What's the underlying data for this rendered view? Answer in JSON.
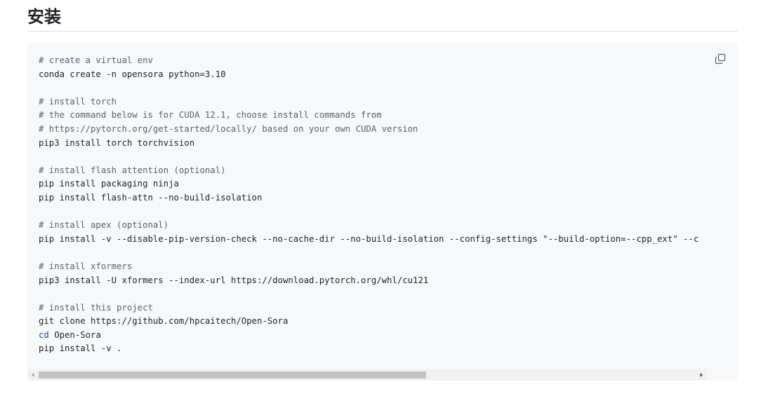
{
  "section": {
    "title": "安装"
  },
  "code_block": {
    "lines": [
      {
        "text": "# create a virtual env",
        "kind": "comment"
      },
      {
        "text": "conda create -n opensora python=3.10",
        "kind": "code"
      },
      {
        "text": "",
        "kind": "blank"
      },
      {
        "text": "# install torch",
        "kind": "comment"
      },
      {
        "text": "# the command below is for CUDA 12.1, choose install commands from",
        "kind": "comment"
      },
      {
        "text": "# https://pytorch.org/get-started/locally/ based on your own CUDA version",
        "kind": "comment"
      },
      {
        "text": "pip3 install torch torchvision",
        "kind": "code"
      },
      {
        "text": "",
        "kind": "blank"
      },
      {
        "text": "# install flash attention (optional)",
        "kind": "comment"
      },
      {
        "text": "pip install packaging ninja",
        "kind": "code"
      },
      {
        "text": "pip install flash-attn --no-build-isolation",
        "kind": "code"
      },
      {
        "text": "",
        "kind": "blank"
      },
      {
        "text": "# install apex (optional)",
        "kind": "comment"
      },
      {
        "text": "pip install -v --disable-pip-version-check --no-cache-dir --no-build-isolation --config-settings \"--build-option=--cpp_ext\" --c",
        "kind": "code"
      },
      {
        "text": "",
        "kind": "blank"
      },
      {
        "text": "# install xformers",
        "kind": "comment"
      },
      {
        "text": "pip3 install -U xformers --index-url https://download.pytorch.org/whl/cu121",
        "kind": "code"
      },
      {
        "text": "",
        "kind": "blank"
      },
      {
        "text": "# install this project",
        "kind": "comment"
      },
      {
        "text": "git clone https://github.com/hpcaitech/Open-Sora",
        "kind": "code"
      },
      {
        "text": "cd Open-Sora",
        "kind": "builtin",
        "keyword": "cd",
        "rest": " Open-Sora"
      },
      {
        "text": "pip install -v .",
        "kind": "code"
      }
    ],
    "copy_icon": "copy-icon",
    "scrollbar": {
      "thumb_fraction": 0.59,
      "scroll_position": 0
    }
  },
  "colors": {
    "code_background": "#f6f8fa",
    "comment": "#59636e",
    "builtin": "#0550ae",
    "text": "#1f2328"
  }
}
